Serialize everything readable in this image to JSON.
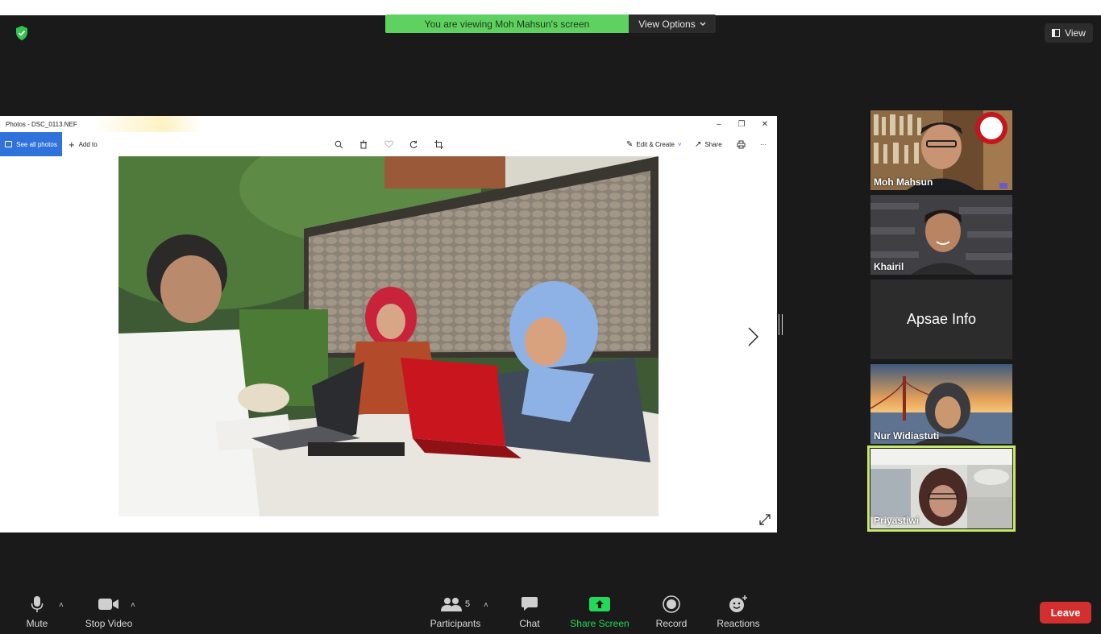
{
  "banner": {
    "viewing_text": "You are viewing Moh Mahsun's screen",
    "view_options_label": "View Options"
  },
  "view_button": {
    "label": "View"
  },
  "photos_window": {
    "title": "Photos - DSC_0113.NEF",
    "see_all_label": "See all photos",
    "add_to_label": "Add to",
    "edit_create_label": "Edit & Create",
    "share_label": "Share",
    "more_label": "···"
  },
  "participants_tiles": [
    {
      "name": "Moh Mahsun"
    },
    {
      "name": "Khairil"
    },
    {
      "name": "Apsae Info"
    },
    {
      "name": "Nur Widiastuti"
    },
    {
      "name": "Priyastiwi"
    }
  ],
  "bottom_bar": {
    "mute_label": "Mute",
    "stop_video_label": "Stop Video",
    "participants_label": "Participants",
    "participants_count": "5",
    "chat_label": "Chat",
    "share_screen_label": "Share Screen",
    "record_label": "Record",
    "reactions_label": "Reactions",
    "leave_label": "Leave"
  },
  "colors": {
    "banner_green": "#5fd160",
    "share_green": "#23d959",
    "leave_red": "#d32f2f",
    "active_outline": "#c6e86b",
    "photos_blue": "#2f72dc"
  }
}
